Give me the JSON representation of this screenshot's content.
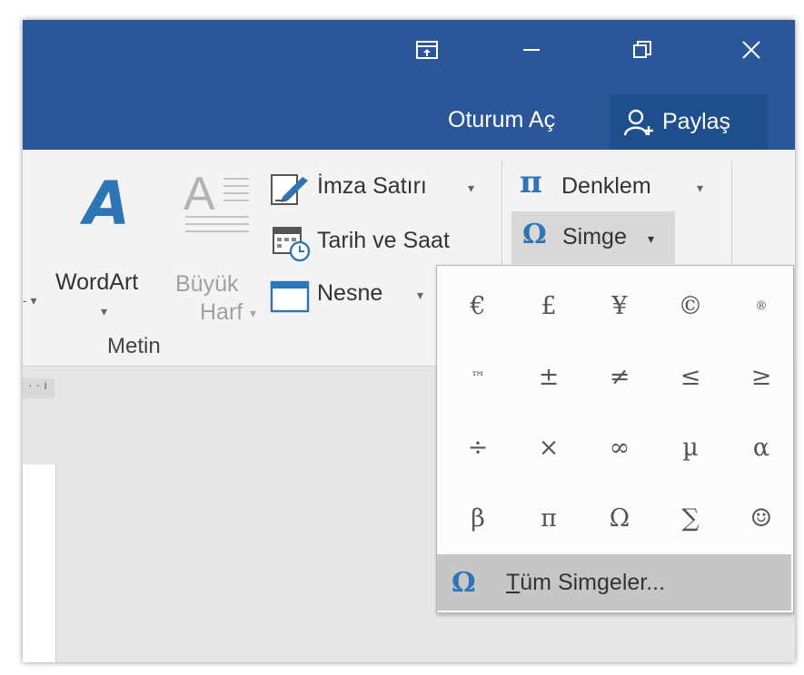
{
  "titlebar": {
    "sign_in": "Oturum Aç",
    "share": "Paylaş",
    "buttons": [
      "ribbon-display-options",
      "minimize",
      "restore",
      "close"
    ]
  },
  "ribbon": {
    "wordart": "WordArt",
    "dropcap_line1": "Büyük",
    "dropcap_line2": "Harf",
    "signature_line": "İmza Satırı",
    "date_time": "Tarih ve Saat",
    "object": "Nesne",
    "equation": "Denklem",
    "symbol": "Simge",
    "group_label": "Metin"
  },
  "symbols": {
    "grid": [
      "€",
      "£",
      "¥",
      "©",
      "®",
      "™",
      "±",
      "≠",
      "≤",
      "≥",
      "÷",
      "×",
      "∞",
      "µ",
      "α",
      "β",
      "π",
      "Ω",
      "∑",
      "☺"
    ],
    "more_prefix": "T",
    "more_rest": "üm Simgeler..."
  },
  "colors": {
    "titlebar": "#2b579a",
    "accent": "#2e75b6"
  }
}
